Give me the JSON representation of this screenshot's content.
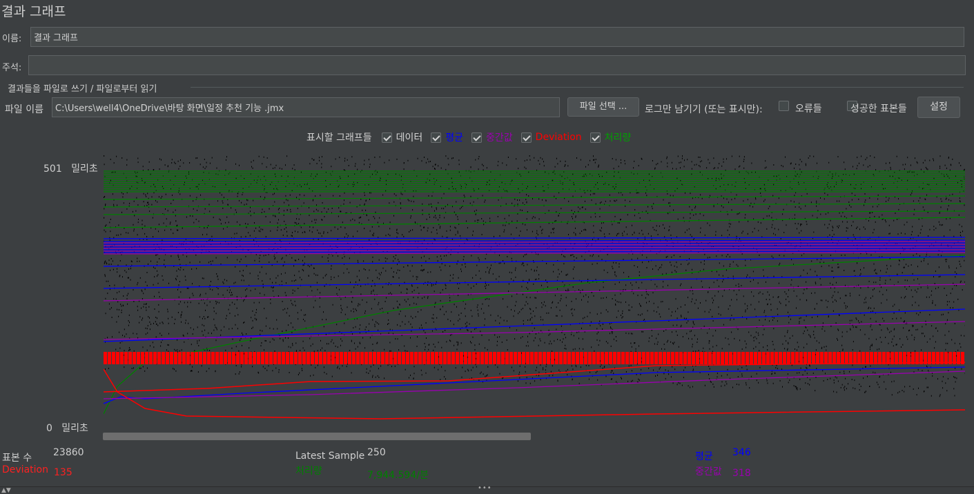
{
  "window": {
    "title": "결과 그래프"
  },
  "form": {
    "name_label": "이름:",
    "name_value": "결과 그래프",
    "comment_label": "주석:",
    "comment_value": ""
  },
  "file_section": {
    "legend": "결과들을 파일로 쓰기 / 파일로부터 읽기",
    "filename_label": "파일 이름",
    "filename_value": "C:\\Users\\well4\\OneDrive\\바탕 화면\\일정 추천 기능 .jmx",
    "browse_button": "파일 선택 ...",
    "log_only_label": "로그만 남기기 (또는 표시만):",
    "errors_label": "오류들",
    "successes_label": "성공한 표본들",
    "settings_button": "설정"
  },
  "graph_options": {
    "label": "표시할 그래프들",
    "items": [
      {
        "label": "데이터",
        "checked": true,
        "color": "#d4d4d4"
      },
      {
        "label": "평균",
        "checked": true,
        "color": "#0000ff"
      },
      {
        "label": "중간값",
        "checked": true,
        "color": "#9a00b0"
      },
      {
        "label": "Deviation",
        "checked": true,
        "color": "#ff0000"
      },
      {
        "label": "처리량",
        "checked": true,
        "color": "#00a000"
      }
    ]
  },
  "axis": {
    "max_label": "501",
    "min_label": "0",
    "unit": "밀리초"
  },
  "chart_data": {
    "type": "scatter",
    "ylim": [
      0,
      501
    ],
    "series": [
      {
        "name": "데이터",
        "color": "#000000"
      },
      {
        "name": "평균",
        "color": "#0000ff",
        "final": 346
      },
      {
        "name": "중간값",
        "color": "#9a00b0",
        "final": 318
      },
      {
        "name": "Deviation",
        "color": "#ff0000",
        "final": 135
      },
      {
        "name": "처리량",
        "color": "#008000",
        "final_text": "7,944.594/분"
      }
    ]
  },
  "stats": {
    "samples_label": "표본 수",
    "samples_value": "23860",
    "latest_label": "Latest Sample",
    "latest_value": "250",
    "average_label": "평균",
    "average_value": "346",
    "deviation_label": "Deviation",
    "deviation_value": "135",
    "throughput_label": "처리량",
    "throughput_value": "7,944.594/분",
    "median_label": "중간값",
    "median_value": "318"
  },
  "colors": {
    "background": "#3c3f41",
    "graph_bg": "#3c3f41",
    "data": "#000000",
    "average": "#0000ff",
    "median": "#9a00b0",
    "deviation": "#ff0000",
    "throughput": "#008000"
  }
}
